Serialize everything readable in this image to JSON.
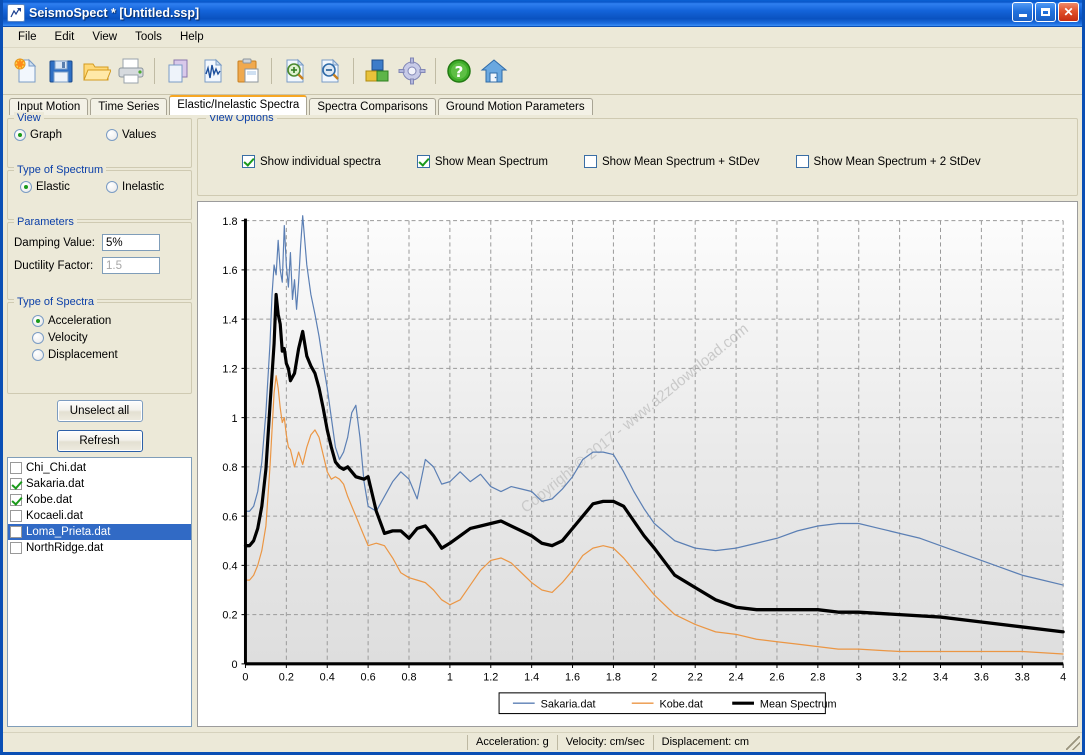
{
  "window": {
    "title": "SeismoSpect * [Untitled.ssp]",
    "minimize_label": "",
    "maximize_label": "",
    "close_label": "✕"
  },
  "menu": [
    "File",
    "Edit",
    "View",
    "Tools",
    "Help"
  ],
  "toolbar": [
    {
      "name": "new-file-icon",
      "title": "New"
    },
    {
      "name": "save-icon",
      "title": "Save"
    },
    {
      "name": "open-folder-icon",
      "title": "Open"
    },
    {
      "name": "print-icon",
      "title": "Print"
    },
    {
      "name": "copy-icon",
      "title": "Copy"
    },
    {
      "name": "waveform-icon",
      "title": "Waveform"
    },
    {
      "name": "paste-icon",
      "title": "Paste"
    },
    {
      "name": "zoom-in-icon",
      "title": "Zoom In"
    },
    {
      "name": "zoom-out-icon",
      "title": "Zoom Out"
    },
    {
      "name": "blocks-icon",
      "title": "Modules"
    },
    {
      "name": "gear-icon",
      "title": "Settings"
    },
    {
      "name": "help-icon",
      "title": "Help"
    },
    {
      "name": "home-icon",
      "title": "Home"
    }
  ],
  "tabs": [
    {
      "label": "Input Motion",
      "active": false
    },
    {
      "label": "Time Series",
      "active": false
    },
    {
      "label": "Elastic/Inelastic Spectra",
      "active": true
    },
    {
      "label": "Spectra Comparisons",
      "active": false
    },
    {
      "label": "Ground Motion Parameters",
      "active": false
    }
  ],
  "sidebar": {
    "view": {
      "legend": "View",
      "options": [
        {
          "label": "Graph",
          "selected": true
        },
        {
          "label": "Values",
          "selected": false
        }
      ]
    },
    "spectrum_type": {
      "legend": "Type of Spectrum",
      "options": [
        {
          "label": "Elastic",
          "selected": true
        },
        {
          "label": "Inelastic",
          "selected": false
        }
      ]
    },
    "parameters": {
      "legend": "Parameters",
      "damping_label": "Damping Value:",
      "damping_value": "5%",
      "ductility_label": "Ductility Factor:",
      "ductility_value": "1.5",
      "ductility_disabled": true
    },
    "spectra_type": {
      "legend": "Type of Spectra",
      "options": [
        {
          "label": "Acceleration",
          "selected": true
        },
        {
          "label": "Velocity",
          "selected": false
        },
        {
          "label": "Displacement",
          "selected": false
        }
      ]
    },
    "unselect_all_label": "Unselect all",
    "refresh_label": "Refresh",
    "files": [
      {
        "label": "Chi_Chi.dat",
        "checked": false,
        "selected": false
      },
      {
        "label": "Sakaria.dat",
        "checked": true,
        "selected": false
      },
      {
        "label": "Kobe.dat",
        "checked": true,
        "selected": false
      },
      {
        "label": "Kocaeli.dat",
        "checked": false,
        "selected": false
      },
      {
        "label": "Loma_Prieta.dat",
        "checked": false,
        "selected": true
      },
      {
        "label": "NorthRidge.dat",
        "checked": false,
        "selected": false
      }
    ]
  },
  "view_options": {
    "legend": "View Options",
    "items": [
      {
        "label": "Show individual spectra",
        "checked": true
      },
      {
        "label": "Show Mean Spectrum",
        "checked": true
      },
      {
        "label": "Show Mean Spectrum + StDev",
        "checked": false
      },
      {
        "label": "Show Mean Spectrum + 2 StDev",
        "checked": false
      }
    ]
  },
  "statusbar": {
    "acceleration": "Acceleration: g",
    "velocity": "Velocity: cm/sec",
    "displacement": "Displacement: cm"
  },
  "watermark": "Copyright © 2017 - www.a2zdownload.com",
  "chart_data": {
    "type": "line",
    "title": "",
    "xlabel": "",
    "ylabel": "",
    "xlim": [
      0,
      4
    ],
    "ylim": [
      0,
      1.8
    ],
    "xticks": [
      0,
      0.2,
      0.4,
      0.6,
      0.8,
      1,
      1.2,
      1.4,
      1.6,
      1.8,
      2,
      2.2,
      2.4,
      2.6,
      2.8,
      3,
      3.2,
      3.4,
      3.6,
      3.8,
      4
    ],
    "xtick_labels": [
      "0",
      "0.2",
      "0.4",
      "0.6",
      "0.8",
      "1",
      "1.2",
      "1.4",
      "1.6",
      "1.8",
      "2",
      "2.2",
      "2.4",
      "2.6",
      "2.8",
      "3",
      "3.2",
      "3.4",
      "3.6",
      "3.8",
      "4"
    ],
    "yticks": [
      0,
      0.2,
      0.4,
      0.6,
      0.8,
      1,
      1.2,
      1.4,
      1.6,
      1.8
    ],
    "ytick_labels": [
      "0",
      "0.2",
      "0.4",
      "0.6",
      "0.8",
      "1",
      "1.2",
      "1.4",
      "1.6",
      "1.8"
    ],
    "grid": true,
    "legend_position": "bottom",
    "colors": {
      "sakaria": "#5b7fb4",
      "kobe": "#eb9644",
      "mean": "#000000"
    },
    "series": [
      {
        "name": "Sakaria.dat",
        "color": "#5b7fb4",
        "x": [
          0,
          0.02,
          0.04,
          0.06,
          0.08,
          0.1,
          0.12,
          0.13,
          0.14,
          0.15,
          0.16,
          0.17,
          0.18,
          0.19,
          0.2,
          0.21,
          0.22,
          0.23,
          0.24,
          0.25,
          0.26,
          0.27,
          0.28,
          0.29,
          0.3,
          0.32,
          0.34,
          0.36,
          0.38,
          0.4,
          0.42,
          0.44,
          0.46,
          0.48,
          0.5,
          0.52,
          0.54,
          0.56,
          0.58,
          0.6,
          0.64,
          0.68,
          0.72,
          0.76,
          0.8,
          0.84,
          0.88,
          0.92,
          0.96,
          1.0,
          1.05,
          1.1,
          1.15,
          1.2,
          1.25,
          1.3,
          1.35,
          1.4,
          1.45,
          1.5,
          1.55,
          1.6,
          1.65,
          1.7,
          1.75,
          1.8,
          1.85,
          1.9,
          1.95,
          2.0,
          2.1,
          2.2,
          2.3,
          2.4,
          2.5,
          2.6,
          2.7,
          2.8,
          2.9,
          3.0,
          3.1,
          3.2,
          3.3,
          3.4,
          3.5,
          3.6,
          3.7,
          3.8,
          3.9,
          4.0
        ],
        "y": [
          0.62,
          0.62,
          0.64,
          0.7,
          0.82,
          1.02,
          1.3,
          1.5,
          1.62,
          1.58,
          1.72,
          1.6,
          1.55,
          1.78,
          1.62,
          1.53,
          1.67,
          1.48,
          1.56,
          1.44,
          1.55,
          1.7,
          1.82,
          1.72,
          1.62,
          1.5,
          1.42,
          1.33,
          1.22,
          1.12,
          1.0,
          0.88,
          0.83,
          0.86,
          0.92,
          1.02,
          1.05,
          0.92,
          0.74,
          0.64,
          0.62,
          0.68,
          0.74,
          0.78,
          0.75,
          0.67,
          0.83,
          0.8,
          0.73,
          0.74,
          0.78,
          0.74,
          0.77,
          0.72,
          0.7,
          0.72,
          0.71,
          0.7,
          0.66,
          0.67,
          0.71,
          0.76,
          0.83,
          0.86,
          0.86,
          0.85,
          0.78,
          0.7,
          0.63,
          0.57,
          0.5,
          0.47,
          0.46,
          0.47,
          0.49,
          0.51,
          0.54,
          0.56,
          0.57,
          0.57,
          0.55,
          0.53,
          0.51,
          0.48,
          0.45,
          0.42,
          0.39,
          0.36,
          0.34,
          0.32
        ]
      },
      {
        "name": "Kobe.dat",
        "color": "#eb9644",
        "x": [
          0,
          0.02,
          0.04,
          0.06,
          0.08,
          0.1,
          0.12,
          0.14,
          0.15,
          0.16,
          0.17,
          0.18,
          0.19,
          0.2,
          0.21,
          0.22,
          0.24,
          0.26,
          0.28,
          0.3,
          0.32,
          0.34,
          0.36,
          0.38,
          0.4,
          0.42,
          0.44,
          0.46,
          0.48,
          0.5,
          0.54,
          0.58,
          0.6,
          0.64,
          0.68,
          0.72,
          0.76,
          0.8,
          0.84,
          0.88,
          0.92,
          0.96,
          1.0,
          1.05,
          1.1,
          1.15,
          1.2,
          1.25,
          1.3,
          1.35,
          1.4,
          1.45,
          1.5,
          1.55,
          1.6,
          1.65,
          1.7,
          1.75,
          1.8,
          1.85,
          1.9,
          1.95,
          2.0,
          2.1,
          2.2,
          2.3,
          2.4,
          2.5,
          2.6,
          2.7,
          2.8,
          2.9,
          3.0,
          3.2,
          3.4,
          3.6,
          3.8,
          4.0
        ],
        "y": [
          0.34,
          0.34,
          0.36,
          0.4,
          0.46,
          0.56,
          0.8,
          1.1,
          1.17,
          1.12,
          1.04,
          0.98,
          1.0,
          0.93,
          0.88,
          0.87,
          0.8,
          0.86,
          0.81,
          0.88,
          0.93,
          0.95,
          0.92,
          0.85,
          0.78,
          0.75,
          0.76,
          0.75,
          0.73,
          0.68,
          0.6,
          0.52,
          0.48,
          0.49,
          0.48,
          0.43,
          0.37,
          0.35,
          0.34,
          0.33,
          0.3,
          0.26,
          0.24,
          0.26,
          0.32,
          0.38,
          0.42,
          0.43,
          0.41,
          0.37,
          0.33,
          0.3,
          0.29,
          0.33,
          0.38,
          0.44,
          0.47,
          0.48,
          0.47,
          0.43,
          0.38,
          0.33,
          0.28,
          0.2,
          0.16,
          0.13,
          0.12,
          0.1,
          0.09,
          0.08,
          0.07,
          0.06,
          0.06,
          0.05,
          0.05,
          0.05,
          0.05,
          0.04
        ]
      },
      {
        "name": "Mean Spectrum",
        "color": "#000000",
        "x": [
          0,
          0.02,
          0.04,
          0.06,
          0.08,
          0.1,
          0.12,
          0.14,
          0.15,
          0.16,
          0.17,
          0.18,
          0.19,
          0.2,
          0.21,
          0.22,
          0.24,
          0.26,
          0.28,
          0.3,
          0.32,
          0.34,
          0.36,
          0.38,
          0.4,
          0.42,
          0.44,
          0.46,
          0.48,
          0.5,
          0.54,
          0.58,
          0.6,
          0.64,
          0.68,
          0.72,
          0.76,
          0.8,
          0.84,
          0.88,
          0.92,
          0.96,
          1.0,
          1.05,
          1.1,
          1.15,
          1.2,
          1.25,
          1.3,
          1.35,
          1.4,
          1.45,
          1.5,
          1.55,
          1.6,
          1.65,
          1.7,
          1.75,
          1.8,
          1.85,
          1.9,
          1.95,
          2.0,
          2.1,
          2.2,
          2.3,
          2.4,
          2.5,
          2.6,
          2.7,
          2.8,
          2.9,
          3.0,
          3.2,
          3.4,
          3.6,
          3.8,
          4.0
        ],
        "y": [
          0.48,
          0.48,
          0.5,
          0.55,
          0.64,
          0.79,
          1.05,
          1.3,
          1.5,
          1.42,
          1.38,
          1.27,
          1.28,
          1.22,
          1.2,
          1.15,
          1.18,
          1.28,
          1.35,
          1.25,
          1.21,
          1.18,
          1.12,
          1.04,
          0.95,
          0.88,
          0.82,
          0.8,
          0.79,
          0.8,
          0.76,
          0.75,
          0.76,
          0.62,
          0.53,
          0.54,
          0.54,
          0.51,
          0.55,
          0.56,
          0.52,
          0.47,
          0.49,
          0.52,
          0.55,
          0.56,
          0.57,
          0.58,
          0.56,
          0.54,
          0.52,
          0.49,
          0.48,
          0.5,
          0.55,
          0.6,
          0.65,
          0.66,
          0.66,
          0.64,
          0.58,
          0.52,
          0.47,
          0.36,
          0.31,
          0.26,
          0.23,
          0.22,
          0.22,
          0.22,
          0.22,
          0.21,
          0.21,
          0.2,
          0.19,
          0.17,
          0.15,
          0.13
        ]
      }
    ]
  }
}
